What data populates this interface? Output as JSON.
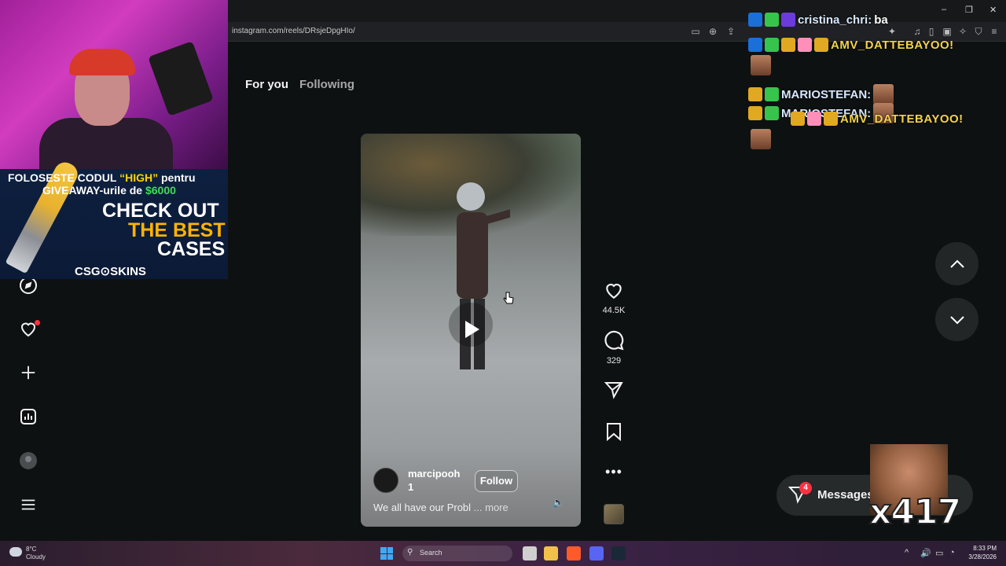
{
  "browser": {
    "url": "instagram.com/reels/DRsjeDpgHIo/",
    "window_controls": [
      "–",
      "❐",
      "✕"
    ]
  },
  "instagram": {
    "tabs": [
      {
        "label": "For you",
        "active": true
      },
      {
        "label": "Following",
        "active": false
      }
    ],
    "reel": {
      "username": "marcipooh 1",
      "username_line1": "marcipooh",
      "username_line2": "1",
      "follow_label": "Follow",
      "caption": "We all have our Probl",
      "caption_more": "... more"
    },
    "actions": {
      "likes": "44.5K",
      "comments": "329"
    },
    "messages": {
      "label": "Messages",
      "badge": "4"
    }
  },
  "stream_overlay": {
    "ad": {
      "line1_a": "FOLOSESTE CODUL ",
      "line1_b": "“HIGH”",
      "line1_c": " pentru",
      "line2_a": "GIVEAWAY-urile de ",
      "line2_b": "$6000",
      "check": "CHECK OUT",
      "best": "THE BEST",
      "cases": "CASES",
      "brand": "CSG⊙SKINS"
    },
    "chat": [
      {
        "user": "cristina_chri:",
        "message": "ba"
      },
      {
        "user": "",
        "message": "AMV_DATTEBAYOO!"
      },
      {
        "user": "MARIOSTEFAN:",
        "message": ""
      },
      {
        "user": "MARIOSTEFAN:",
        "message": ""
      },
      {
        "user": "",
        "message": "AMV_DATTEBAYOO!"
      }
    ],
    "emote_counter": "x417"
  },
  "taskbar": {
    "temp": "8°C",
    "weather": "Cloudy",
    "search_placeholder": "Search",
    "time": "8:33 PM",
    "date": "3/28/2026"
  },
  "colors": {
    "background": "#0e1111",
    "notification": "#ff3040",
    "ad_yellow": "#ffd200",
    "ad_green": "#3dde5a"
  }
}
